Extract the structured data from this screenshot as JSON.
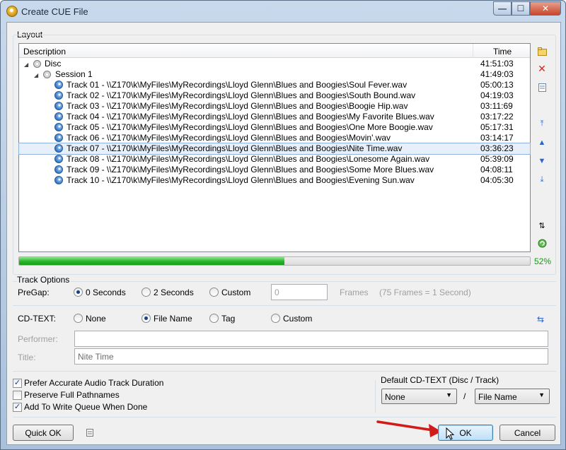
{
  "window": {
    "title": "Create CUE File",
    "controls": [
      "—",
      "☐",
      "✕"
    ]
  },
  "layout": {
    "label": "Layout",
    "columns": {
      "description": "Description",
      "time": "Time"
    },
    "disc": {
      "label": "Disc",
      "time": "41:51:03"
    },
    "session": {
      "label": "Session 1",
      "time": "41:49:03"
    },
    "tracks": [
      {
        "label": "Track 01 - \\\\Z170\\k\\MyFiles\\MyRecordings\\Lloyd Glenn\\Blues and Boogies\\Soul Fever.wav",
        "time": "05:00:13"
      },
      {
        "label": "Track 02 - \\\\Z170\\k\\MyFiles\\MyRecordings\\Lloyd Glenn\\Blues and Boogies\\South Bound.wav",
        "time": "04:19:03"
      },
      {
        "label": "Track 03 - \\\\Z170\\k\\MyFiles\\MyRecordings\\Lloyd Glenn\\Blues and Boogies\\Boogie Hip.wav",
        "time": "03:11:69"
      },
      {
        "label": "Track 04 - \\\\Z170\\k\\MyFiles\\MyRecordings\\Lloyd Glenn\\Blues and Boogies\\My Favorite Blues.wav",
        "time": "03:17:22"
      },
      {
        "label": "Track 05 - \\\\Z170\\k\\MyFiles\\MyRecordings\\Lloyd Glenn\\Blues and Boogies\\One More Boogie.wav",
        "time": "05:17:31"
      },
      {
        "label": "Track 06 - \\\\Z170\\k\\MyFiles\\MyRecordings\\Lloyd Glenn\\Blues and Boogies\\Movin'.wav",
        "time": "03:14:17"
      },
      {
        "label": "Track 07 - \\\\Z170\\k\\MyFiles\\MyRecordings\\Lloyd Glenn\\Blues and Boogies\\Nite Time.wav",
        "time": "03:36:23"
      },
      {
        "label": "Track 08 - \\\\Z170\\k\\MyFiles\\MyRecordings\\Lloyd Glenn\\Blues and Boogies\\Lonesome Again.wav",
        "time": "05:39:09"
      },
      {
        "label": "Track 09 - \\\\Z170\\k\\MyFiles\\MyRecordings\\Lloyd Glenn\\Blues and Boogies\\Some More Blues.wav",
        "time": "04:08:11"
      },
      {
        "label": "Track 10 - \\\\Z170\\k\\MyFiles\\MyRecordings\\Lloyd Glenn\\Blues and Boogies\\Evening Sun.wav",
        "time": "04:05:30"
      }
    ],
    "selected_track": "Track 07",
    "progress": {
      "value": 0.52,
      "text": "52%"
    },
    "side_icons": [
      "add-file-icon",
      "delete-icon",
      "properties-icon",
      "move-top-icon",
      "move-up-icon",
      "move-down-icon",
      "move-bottom-icon",
      "sort-icon",
      "refresh-icon"
    ]
  },
  "track_options": {
    "label": "Track Options",
    "pregap": {
      "label": "PreGap:",
      "options": [
        "0 Seconds",
        "2 Seconds",
        "Custom"
      ],
      "selected": "0 Seconds",
      "custom_value": "0",
      "frames_label": "Frames",
      "hint": "(75 Frames = 1 Second)"
    },
    "cdtext": {
      "label": "CD-TEXT:",
      "options": [
        "None",
        "File Name",
        "Tag",
        "Custom"
      ],
      "selected": "File Name"
    },
    "performer": {
      "label": "Performer:",
      "value": ""
    },
    "title": {
      "label": "Title:",
      "value": "Nite Time"
    }
  },
  "checkboxes": [
    {
      "label": "Prefer Accurate Audio Track Duration",
      "checked": true
    },
    {
      "label": "Preserve Full Pathnames",
      "checked": false
    },
    {
      "label": "Add To Write Queue When Done",
      "checked": true
    }
  ],
  "default_cdtext": {
    "label": "Default CD-TEXT (Disc / Track)",
    "disc_value": "None",
    "separator": "/",
    "track_value": "File Name"
  },
  "buttons": {
    "quick_ok": "Quick OK",
    "ok": "OK",
    "cancel": "Cancel"
  },
  "colors": {
    "progress": "#26b526",
    "percent_text": "#129d12",
    "annotation_arrow": "#d11a1a",
    "selection": "#e6effa"
  }
}
